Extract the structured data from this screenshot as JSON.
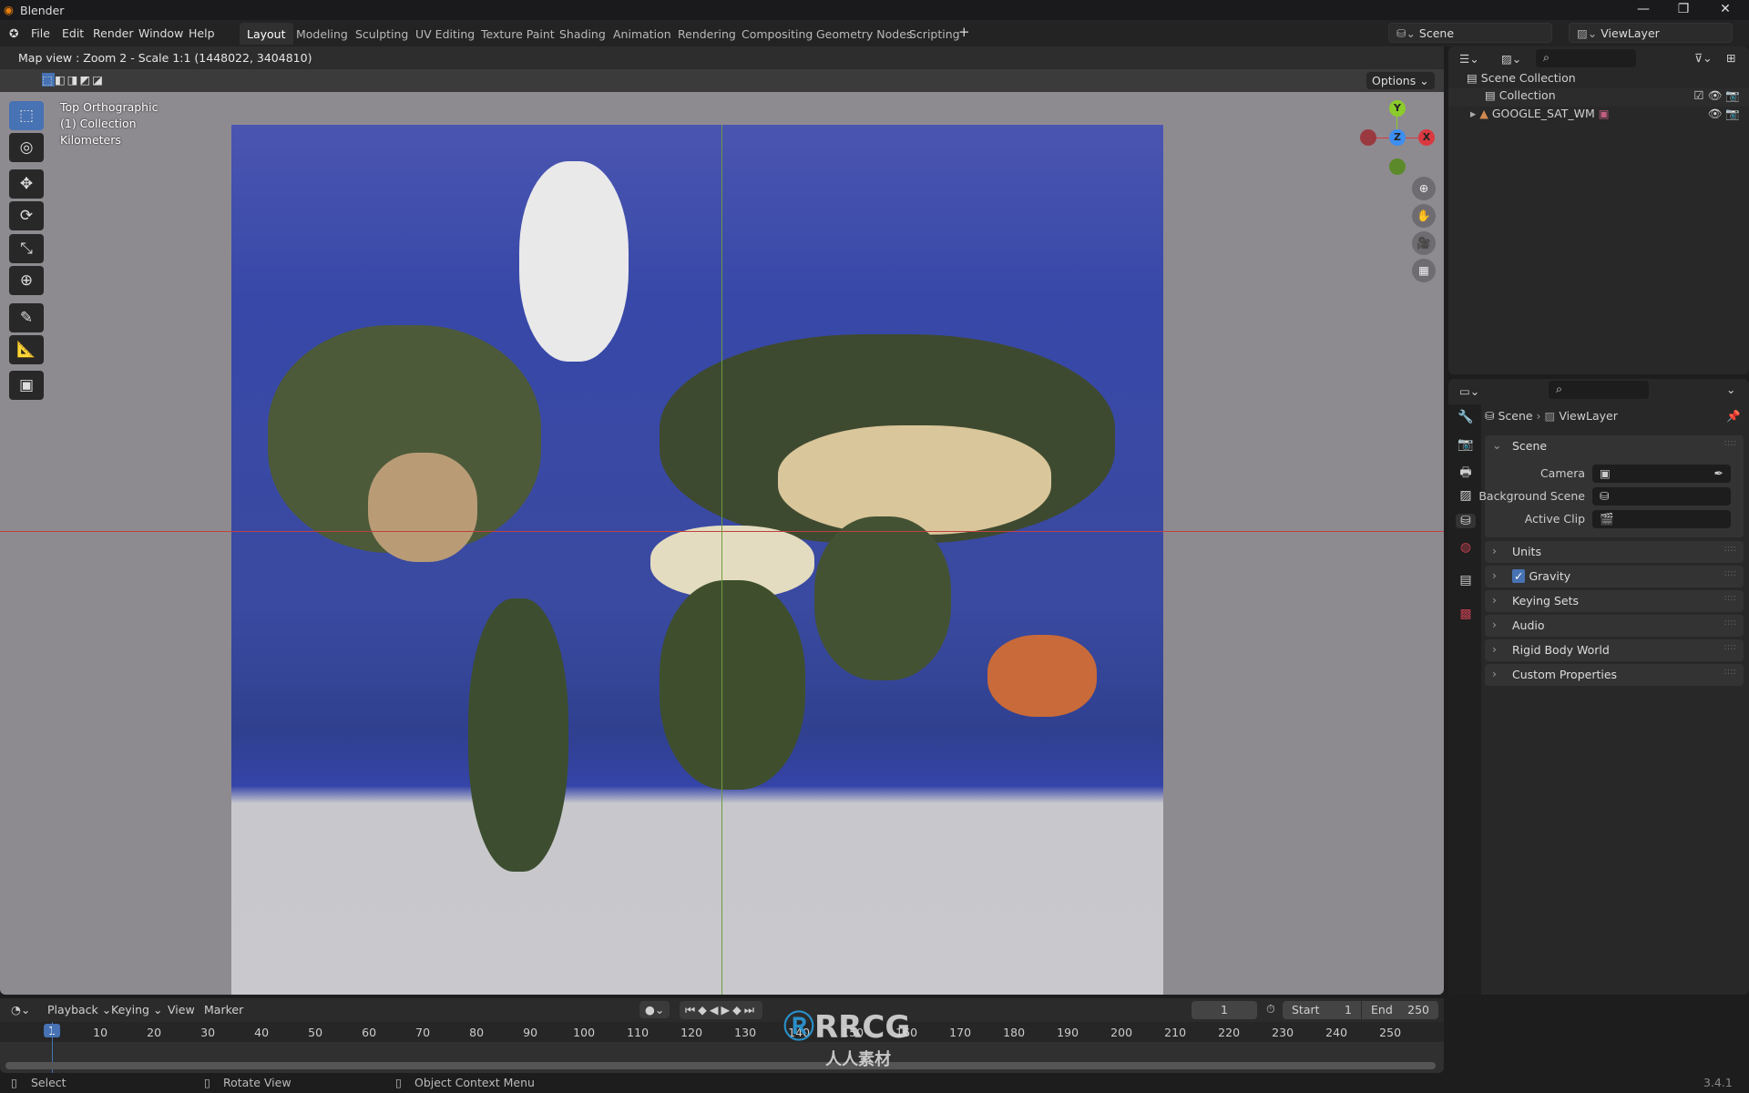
{
  "window": {
    "title": "Blender",
    "minimize": "—",
    "maximize": "❐",
    "close": "✕"
  },
  "menu": [
    "File",
    "Edit",
    "Render",
    "Window",
    "Help"
  ],
  "workspaces": [
    {
      "label": "Layout",
      "active": true
    },
    {
      "label": "Modeling"
    },
    {
      "label": "Sculpting"
    },
    {
      "label": "UV Editing"
    },
    {
      "label": "Texture Paint"
    },
    {
      "label": "Shading"
    },
    {
      "label": "Animation"
    },
    {
      "label": "Rendering"
    },
    {
      "label": "Compositing"
    },
    {
      "label": "Geometry Nodes"
    },
    {
      "label": "Scripting"
    }
  ],
  "add_workspace": "+",
  "scene_selector": {
    "value": "Scene"
  },
  "viewlayer_selector": {
    "value": "ViewLayer"
  },
  "viewport": {
    "header_text": "Map view : Zoom 2 - Scale 1:1 (1448022, 3404810)",
    "options_label": "Options ⌄",
    "overlay": [
      "Top Orthographic",
      "(1) Collection",
      "Kilometers"
    ],
    "gizmo": {
      "y": "Y",
      "z": "Z",
      "x": "X"
    },
    "axis_colors": {
      "x": "#d9393f",
      "y": "#8bcb2c",
      "z": "#3d8ef0"
    }
  },
  "tools": [
    {
      "name": "select-box",
      "icon": "⬚"
    },
    {
      "name": "cursor",
      "icon": "◎"
    },
    {
      "name": "move",
      "icon": "✥"
    },
    {
      "name": "rotate",
      "icon": "⟳"
    },
    {
      "name": "scale",
      "icon": "⤡"
    },
    {
      "name": "transform",
      "icon": "⊕"
    },
    {
      "name": "annotate",
      "icon": "✎"
    },
    {
      "name": "measure",
      "icon": "📐"
    },
    {
      "name": "add-cube",
      "icon": "▣"
    }
  ],
  "outliner": {
    "items": [
      {
        "label": "Scene Collection"
      },
      {
        "label": "Collection"
      },
      {
        "label": "GOOGLE_SAT_WM"
      }
    ]
  },
  "properties": {
    "breadcrumb": [
      "Scene",
      "ViewLayer"
    ],
    "section": "Scene",
    "fields": [
      {
        "label": "Camera"
      },
      {
        "label": "Background Scene"
      },
      {
        "label": "Active Clip"
      }
    ],
    "panels": [
      "Units",
      "Gravity",
      "Keying Sets",
      "Audio",
      "Rigid Body World",
      "Custom Properties"
    ],
    "gravity_checked": true
  },
  "timeline": {
    "menus": [
      "Playback ⌄",
      "Keying ⌄",
      "View",
      "Marker"
    ],
    "current_frame": "1",
    "start_label": "Start",
    "start": "1",
    "end_label": "End",
    "end": "250",
    "frames": [
      "1",
      "10",
      "20",
      "30",
      "40",
      "50",
      "60",
      "70",
      "80",
      "90",
      "100",
      "110",
      "120",
      "130",
      "140",
      "150",
      "160",
      "170",
      "180",
      "190",
      "200",
      "210",
      "220",
      "230",
      "240",
      "250"
    ]
  },
  "status": {
    "select": "Select",
    "rotate": "Rotate View",
    "context": "Object Context Menu",
    "version": "3.4.1"
  },
  "watermark": {
    "text": "RRCG",
    "sub": "人人素材"
  }
}
